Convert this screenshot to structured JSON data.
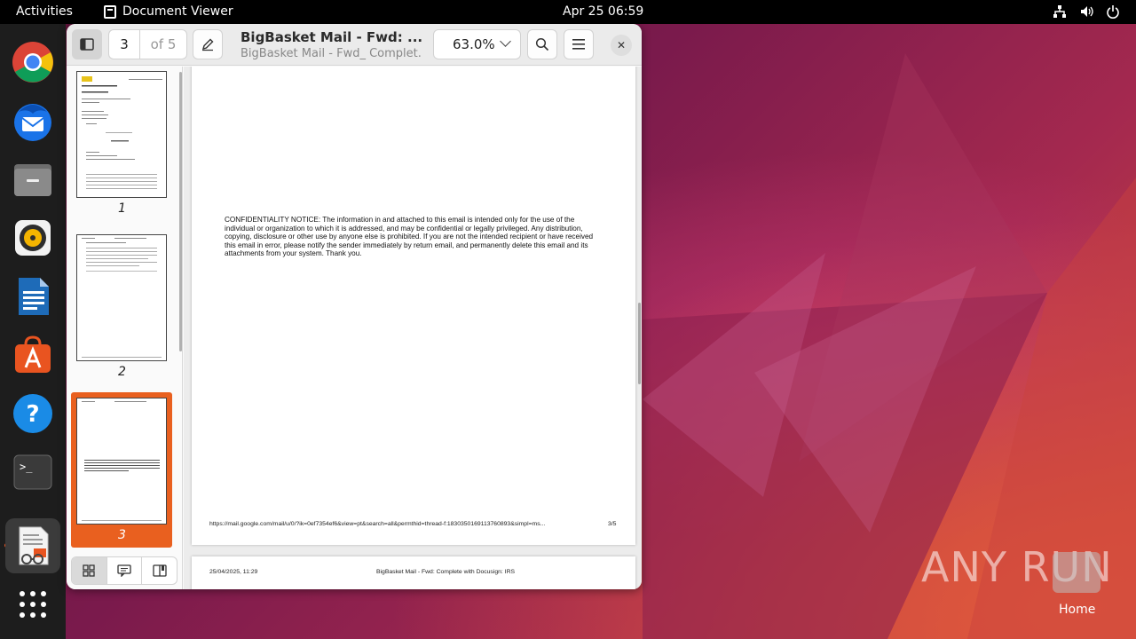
{
  "topbar": {
    "activities": "Activities",
    "app_name": "Document Viewer",
    "clock": "Apr 25  06:59"
  },
  "dock": {
    "items": [
      "chrome",
      "thunderbird",
      "files",
      "rhythmbox",
      "libreoffice-writer",
      "app-center",
      "help",
      "terminal",
      "document-viewer",
      "show-apps"
    ]
  },
  "window": {
    "page_current": "3",
    "page_of": "of 5",
    "title": "BigBasket Mail - Fwd: ...",
    "subtitle": "BigBasket Mail - Fwd_ Complet...",
    "zoom": "63.0%"
  },
  "sidebar": {
    "thumbnails": [
      {
        "label": "1"
      },
      {
        "label": "2"
      },
      {
        "label": "3"
      }
    ],
    "selected_index": 3,
    "accent_color": "#e9601f"
  },
  "document": {
    "notice": "CONFIDENTIALITY NOTICE: The information in and attached to this email is intended only for the use of the individual or organization to which it is addressed, and may be confidential or legally privileged. Any distribution, copying, disclosure or other use by anyone else is prohibited. If you are not the intended recipient or have received this email in error, please notify the sender immediately by return email, and permanently delete this email and its attachments from your system. Thank you.",
    "footer_url": "https://mail.google.com/mail/u/0/?ik=0ef7354ef6&view=pt&search=all&permthid=thread-f:1830350169113760893&simpl=ms...",
    "footer_page": "3/5",
    "next_page_date": "25/04/2025, 11:29",
    "next_page_title": "BigBasket Mail - Fwd: Complete with Docusign: IRS"
  },
  "desktop": {
    "watermark": "ANY RUN",
    "home_label": "Home"
  }
}
